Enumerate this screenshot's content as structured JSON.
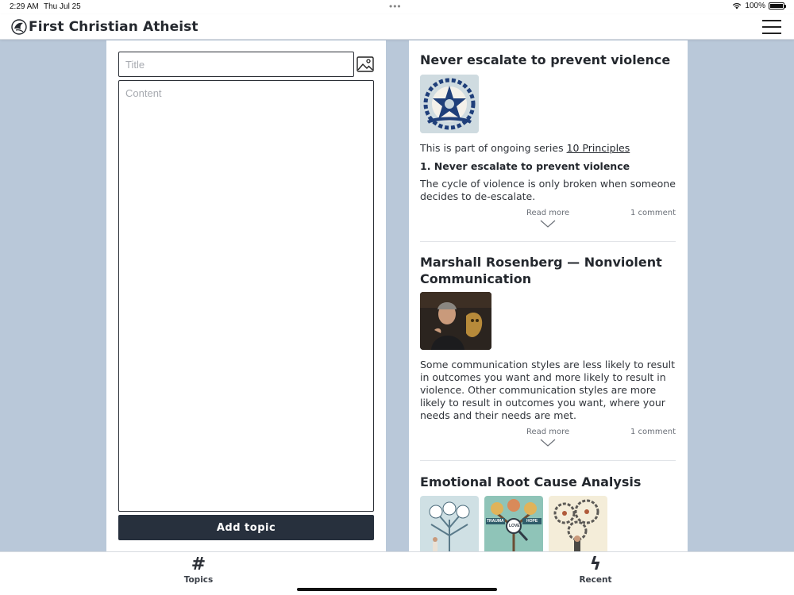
{
  "status_bar": {
    "time": "2:29 AM",
    "date": "Thu Jul 25",
    "battery": "100%",
    "battery_level": 1.0
  },
  "header": {
    "title": "First Christian Atheist",
    "logo_icon": "dove-logo-icon",
    "menu_icon": "hamburger-menu-icon"
  },
  "form": {
    "title_placeholder": "Title",
    "content_placeholder": "Content",
    "image_icon": "image-icon",
    "submit_label": "Add topic"
  },
  "posts": [
    {
      "title": "Never escalate to prevent violence",
      "intro_prefix": "This is part of ongoing series ",
      "series_link": "10 Principles",
      "subtitle": "1. Never escalate to prevent violence",
      "excerpt": "The cycle of violence is only broken when someone decides to de-escalate.",
      "read_more": "Read more",
      "comments": "1 comment"
    },
    {
      "title": "Marshall Rosenberg — Nonviolent Communication",
      "excerpt": "Some communication styles are less likely to result in outcomes you want and more likely to result in violence. Other communication styles are more likely to result in outcomes you want, where your needs and their needs are met.",
      "read_more": "Read more",
      "comments": "1 comment"
    },
    {
      "title": "Emotional Root Cause Analysis",
      "thumb_labels": [
        "TRAUMA",
        "LOVE",
        "HOPE"
      ]
    }
  ],
  "tabbar": {
    "tabs": [
      {
        "icon": "#",
        "label": "Topics"
      },
      {
        "icon": "ϟ",
        "label": "Recent"
      }
    ]
  },
  "colors": {
    "background": "#b9c8d9",
    "button": "#27303d",
    "text": "#24282e"
  }
}
